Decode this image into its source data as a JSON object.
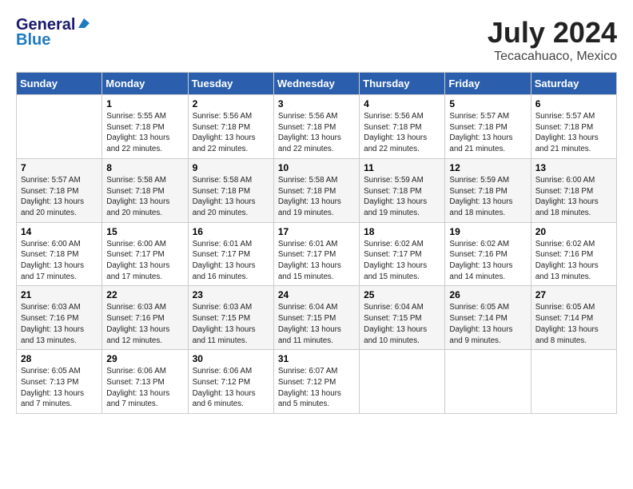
{
  "header": {
    "logo_line1": "General",
    "logo_line2": "Blue",
    "month_title": "July 2024",
    "location": "Tecacahuaco, Mexico"
  },
  "weekdays": [
    "Sunday",
    "Monday",
    "Tuesday",
    "Wednesday",
    "Thursday",
    "Friday",
    "Saturday"
  ],
  "weeks": [
    [
      {
        "day": "",
        "sunrise": "",
        "sunset": "",
        "daylight": ""
      },
      {
        "day": "1",
        "sunrise": "Sunrise: 5:55 AM",
        "sunset": "Sunset: 7:18 PM",
        "daylight": "Daylight: 13 hours and 22 minutes."
      },
      {
        "day": "2",
        "sunrise": "Sunrise: 5:56 AM",
        "sunset": "Sunset: 7:18 PM",
        "daylight": "Daylight: 13 hours and 22 minutes."
      },
      {
        "day": "3",
        "sunrise": "Sunrise: 5:56 AM",
        "sunset": "Sunset: 7:18 PM",
        "daylight": "Daylight: 13 hours and 22 minutes."
      },
      {
        "day": "4",
        "sunrise": "Sunrise: 5:56 AM",
        "sunset": "Sunset: 7:18 PM",
        "daylight": "Daylight: 13 hours and 22 minutes."
      },
      {
        "day": "5",
        "sunrise": "Sunrise: 5:57 AM",
        "sunset": "Sunset: 7:18 PM",
        "daylight": "Daylight: 13 hours and 21 minutes."
      },
      {
        "day": "6",
        "sunrise": "Sunrise: 5:57 AM",
        "sunset": "Sunset: 7:18 PM",
        "daylight": "Daylight: 13 hours and 21 minutes."
      }
    ],
    [
      {
        "day": "7",
        "sunrise": "Sunrise: 5:57 AM",
        "sunset": "Sunset: 7:18 PM",
        "daylight": "Daylight: 13 hours and 20 minutes."
      },
      {
        "day": "8",
        "sunrise": "Sunrise: 5:58 AM",
        "sunset": "Sunset: 7:18 PM",
        "daylight": "Daylight: 13 hours and 20 minutes."
      },
      {
        "day": "9",
        "sunrise": "Sunrise: 5:58 AM",
        "sunset": "Sunset: 7:18 PM",
        "daylight": "Daylight: 13 hours and 20 minutes."
      },
      {
        "day": "10",
        "sunrise": "Sunrise: 5:58 AM",
        "sunset": "Sunset: 7:18 PM",
        "daylight": "Daylight: 13 hours and 19 minutes."
      },
      {
        "day": "11",
        "sunrise": "Sunrise: 5:59 AM",
        "sunset": "Sunset: 7:18 PM",
        "daylight": "Daylight: 13 hours and 19 minutes."
      },
      {
        "day": "12",
        "sunrise": "Sunrise: 5:59 AM",
        "sunset": "Sunset: 7:18 PM",
        "daylight": "Daylight: 13 hours and 18 minutes."
      },
      {
        "day": "13",
        "sunrise": "Sunrise: 6:00 AM",
        "sunset": "Sunset: 7:18 PM",
        "daylight": "Daylight: 13 hours and 18 minutes."
      }
    ],
    [
      {
        "day": "14",
        "sunrise": "Sunrise: 6:00 AM",
        "sunset": "Sunset: 7:18 PM",
        "daylight": "Daylight: 13 hours and 17 minutes."
      },
      {
        "day": "15",
        "sunrise": "Sunrise: 6:00 AM",
        "sunset": "Sunset: 7:17 PM",
        "daylight": "Daylight: 13 hours and 17 minutes."
      },
      {
        "day": "16",
        "sunrise": "Sunrise: 6:01 AM",
        "sunset": "Sunset: 7:17 PM",
        "daylight": "Daylight: 13 hours and 16 minutes."
      },
      {
        "day": "17",
        "sunrise": "Sunrise: 6:01 AM",
        "sunset": "Sunset: 7:17 PM",
        "daylight": "Daylight: 13 hours and 15 minutes."
      },
      {
        "day": "18",
        "sunrise": "Sunrise: 6:02 AM",
        "sunset": "Sunset: 7:17 PM",
        "daylight": "Daylight: 13 hours and 15 minutes."
      },
      {
        "day": "19",
        "sunrise": "Sunrise: 6:02 AM",
        "sunset": "Sunset: 7:16 PM",
        "daylight": "Daylight: 13 hours and 14 minutes."
      },
      {
        "day": "20",
        "sunrise": "Sunrise: 6:02 AM",
        "sunset": "Sunset: 7:16 PM",
        "daylight": "Daylight: 13 hours and 13 minutes."
      }
    ],
    [
      {
        "day": "21",
        "sunrise": "Sunrise: 6:03 AM",
        "sunset": "Sunset: 7:16 PM",
        "daylight": "Daylight: 13 hours and 13 minutes."
      },
      {
        "day": "22",
        "sunrise": "Sunrise: 6:03 AM",
        "sunset": "Sunset: 7:16 PM",
        "daylight": "Daylight: 13 hours and 12 minutes."
      },
      {
        "day": "23",
        "sunrise": "Sunrise: 6:03 AM",
        "sunset": "Sunset: 7:15 PM",
        "daylight": "Daylight: 13 hours and 11 minutes."
      },
      {
        "day": "24",
        "sunrise": "Sunrise: 6:04 AM",
        "sunset": "Sunset: 7:15 PM",
        "daylight": "Daylight: 13 hours and 11 minutes."
      },
      {
        "day": "25",
        "sunrise": "Sunrise: 6:04 AM",
        "sunset": "Sunset: 7:15 PM",
        "daylight": "Daylight: 13 hours and 10 minutes."
      },
      {
        "day": "26",
        "sunrise": "Sunrise: 6:05 AM",
        "sunset": "Sunset: 7:14 PM",
        "daylight": "Daylight: 13 hours and 9 minutes."
      },
      {
        "day": "27",
        "sunrise": "Sunrise: 6:05 AM",
        "sunset": "Sunset: 7:14 PM",
        "daylight": "Daylight: 13 hours and 8 minutes."
      }
    ],
    [
      {
        "day": "28",
        "sunrise": "Sunrise: 6:05 AM",
        "sunset": "Sunset: 7:13 PM",
        "daylight": "Daylight: 13 hours and 7 minutes."
      },
      {
        "day": "29",
        "sunrise": "Sunrise: 6:06 AM",
        "sunset": "Sunset: 7:13 PM",
        "daylight": "Daylight: 13 hours and 7 minutes."
      },
      {
        "day": "30",
        "sunrise": "Sunrise: 6:06 AM",
        "sunset": "Sunset: 7:12 PM",
        "daylight": "Daylight: 13 hours and 6 minutes."
      },
      {
        "day": "31",
        "sunrise": "Sunrise: 6:07 AM",
        "sunset": "Sunset: 7:12 PM",
        "daylight": "Daylight: 13 hours and 5 minutes."
      },
      {
        "day": "",
        "sunrise": "",
        "sunset": "",
        "daylight": ""
      },
      {
        "day": "",
        "sunrise": "",
        "sunset": "",
        "daylight": ""
      },
      {
        "day": "",
        "sunrise": "",
        "sunset": "",
        "daylight": ""
      }
    ]
  ]
}
